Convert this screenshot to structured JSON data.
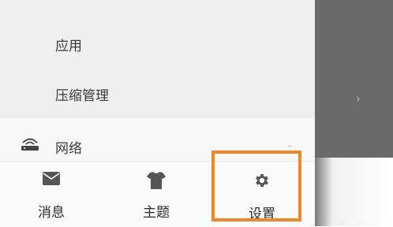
{
  "drawer": {
    "sub_items": [
      "应用",
      "压缩管理"
    ],
    "network": {
      "label": "网络",
      "icon": "router-icon"
    }
  },
  "tabbar": {
    "tabs": [
      {
        "label": "消息",
        "icon": "envelope-icon"
      },
      {
        "label": "主题",
        "icon": "tshirt-icon"
      },
      {
        "label": "设置",
        "icon": "gear-icon"
      }
    ]
  },
  "colors": {
    "highlight": "#f0862c",
    "scrim": "#6a6a6a",
    "text": "#3a3a3a"
  }
}
